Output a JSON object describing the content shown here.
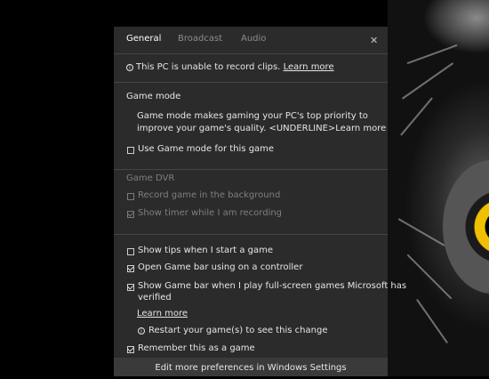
{
  "tabs": [
    {
      "label": "General"
    },
    {
      "label": "Broadcast"
    },
    {
      "label": "Audio"
    }
  ],
  "notice": {
    "text": "This PC is unable to record clips.",
    "link": "Learn more",
    "icon": "info-icon"
  },
  "game_mode": {
    "heading": "Game mode",
    "line1": "Game mode makes gaming your PC's top priority to",
    "line2": "improve your game's quality. <UNDERLINE>Learn more",
    "checkbox": {
      "label": "Use Game mode for this game",
      "checked": false
    }
  },
  "game_dvr": {
    "heading": "Game DVR",
    "items": [
      {
        "label": "Record game in the background",
        "checked": false
      },
      {
        "label": "Show timer while I am recording",
        "checked": true
      }
    ]
  },
  "options": {
    "show_tips": {
      "label": "Show tips when I start a game",
      "checked": false
    },
    "open_bar": {
      "label": "Open Game bar using  on a controller",
      "checked": true
    },
    "fullscreen": {
      "line1": "Show Game bar when I play full-screen games Microsoft has",
      "line2": "verified",
      "checked": true
    },
    "learn_more": "Learn more",
    "restart_note": "Restart your game(s) to see this change",
    "remember": {
      "label": "Remember this as a game",
      "checked": true
    }
  },
  "footer": {
    "label": "Edit more preferences in Windows Settings"
  },
  "close_glyph": "✕"
}
